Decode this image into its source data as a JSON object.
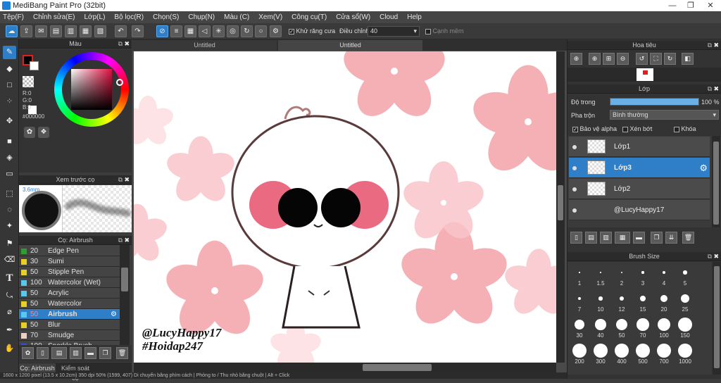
{
  "app": {
    "title": "MediBang Paint Pro (32bit)"
  },
  "window": {
    "minimize": "—",
    "maximize": "❐",
    "close": "✕"
  },
  "menu": [
    "Tệp(F)",
    "Chỉnh sửa(E)",
    "Lớp(L)",
    "Bộ lọc(R)",
    "Chọn(S)",
    "Chụp(N)",
    "Màu (C)",
    "Xem(V)",
    "Công cụ(T)",
    "Cửa sổ(W)",
    "Cloud",
    "Help"
  ],
  "toolbar": {
    "antialias_label": "Khử răng cưa",
    "correction_label": "Điều chỉnh",
    "correction_value": "40",
    "edge_label": "Cạnh mềm"
  },
  "color_panel": {
    "title": "Màu",
    "r": "R:0",
    "g": "G:0",
    "b": "B:0",
    "hex": "#000000",
    "fg_color": "#000000",
    "bg_color": "#ffffff"
  },
  "preview_panel": {
    "title": "Xem trước cọ",
    "size": "3.6mm"
  },
  "brush_panel": {
    "title": "Cọ: Airbrush",
    "items": [
      {
        "size": "20",
        "name": "Edge Pen",
        "color": "#2e9e2e"
      },
      {
        "size": "30",
        "name": "Sumi",
        "color": "#e8d020"
      },
      {
        "size": "50",
        "name": "Stipple Pen",
        "color": "#e8d020"
      },
      {
        "size": "100",
        "name": "Watercolor (Wet)",
        "color": "#58c8f0"
      },
      {
        "size": "50",
        "name": "Acrylic",
        "color": "#58c8f0"
      },
      {
        "size": "50",
        "name": "Watercolor",
        "color": "#e8d020"
      },
      {
        "size": "50",
        "name": "Airbrush",
        "color": "#58c8f0",
        "selected": true
      },
      {
        "size": "50",
        "name": "Blur",
        "color": "#e8d020"
      },
      {
        "size": "70",
        "name": "Smudge",
        "color": "#f0d0c0"
      },
      {
        "size": "100",
        "name": "Sparkle Brush",
        "color": "#3050e0"
      }
    ]
  },
  "bottom_tabs": {
    "brush": "Cọ: Airbrush",
    "control": "Kiểm soát cọ"
  },
  "canvas": {
    "tab1": "Untitled",
    "tab2": "Untitled",
    "watermark_line1": "@LucyHappy17",
    "watermark_line2": "#Hoidap247"
  },
  "navigator": {
    "title": "Hoa tiêu"
  },
  "layer_panel": {
    "title": "Lớp",
    "opacity_label": "Độ trong",
    "opacity_value": "100 %",
    "opacity": 1.0,
    "blend_label": "Pha trộn",
    "blend_value": "Bình thường",
    "protect_alpha": "Bảo vệ alpha",
    "clip": "Xén bớt",
    "lock": "Khóa",
    "layers": [
      {
        "name": "Lớp1",
        "selected": false
      },
      {
        "name": "Lớp3",
        "selected": true
      },
      {
        "name": "Lớp2",
        "selected": false
      },
      {
        "name": "@LucyHappy17",
        "selected": false
      }
    ]
  },
  "brush_size_panel": {
    "title": "Brush Size",
    "sizes": [
      "1",
      "1.5",
      "2",
      "3",
      "4",
      "5",
      "7",
      "10",
      "12",
      "15",
      "20",
      "25",
      "30",
      "40",
      "50",
      "70",
      "100",
      "150",
      "200",
      "300",
      "400",
      "500",
      "700",
      "1000"
    ]
  },
  "status": {
    "text": "1600 x 1200 pixel (13.5 x 10.2cm) 350 dpi 50% (1599, 407) Di chuyển bằng phím cách | Phóng to / Thu nhỏ bằng chuột | Alt + Click"
  }
}
